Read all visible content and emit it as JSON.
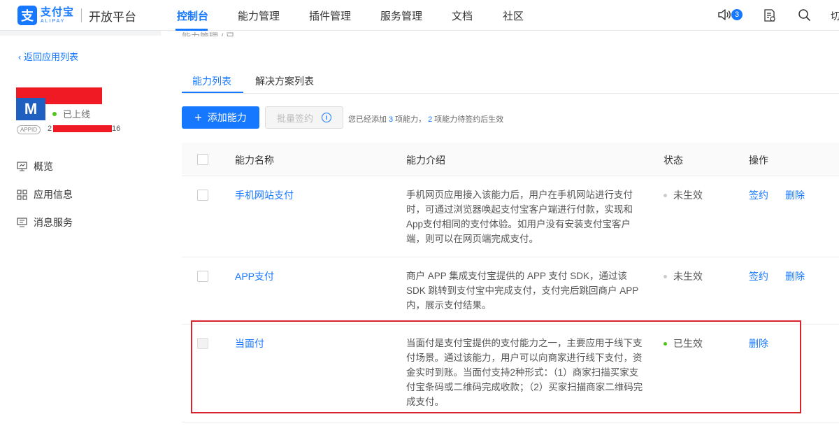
{
  "brand": {
    "logo_glyph": "支",
    "name_cn": "支付宝",
    "name_en": "ALIPAY",
    "platform": "开放平台",
    "color": "#1677ff"
  },
  "nav": {
    "items": [
      {
        "label": "控制台",
        "active": true
      },
      {
        "label": "能力管理"
      },
      {
        "label": "插件管理"
      },
      {
        "label": "服务管理"
      },
      {
        "label": "文档"
      },
      {
        "label": "社区"
      }
    ],
    "notification_count": "3",
    "icons": [
      "speaker-icon",
      "document-list-icon",
      "search-icon"
    ],
    "overflow_text": "切"
  },
  "sidebar": {
    "back_link": "返回应用列表",
    "app": {
      "logo_text": "M",
      "status": "已上线",
      "appid_tag": "APPID",
      "appid_prefix": "2",
      "appid_suffix": "16"
    },
    "items": [
      {
        "label": "概览",
        "icon": "monitor-icon"
      },
      {
        "label": "应用信息",
        "icon": "grid-icon"
      },
      {
        "label": "消息服务",
        "icon": "message-icon"
      }
    ]
  },
  "main": {
    "breadcrumb_fragment": "能力管理 / 已...",
    "tabs": [
      {
        "label": "能力列表",
        "active": true
      },
      {
        "label": "解决方案列表"
      }
    ],
    "add_button": "添加能力",
    "batch_sign_button": "批量签约",
    "summary": {
      "part1": "您已经添加",
      "count_added": "3",
      "part2": "项能力，",
      "count_pending": "2",
      "part3": "项能力待签约后生效"
    },
    "table": {
      "headers": {
        "name": "能力名称",
        "intro": "能力介绍",
        "status": "状态",
        "ops": "操作"
      },
      "rows": [
        {
          "name": "手机网站支付",
          "intro": "手机网页应用接入该能力后，用户在手机网站进行支付时，可通过浏览器唤起支付宝客户端进行付款，实现和App支付相同的支付体验。如用户没有安装支付宝客户端，则可以在网页端完成支付。",
          "status": "未生效",
          "sign": "签约",
          "delete": "删除"
        },
        {
          "name": "APP支付",
          "intro": "商户 APP 集成支付宝提供的 APP 支付 SDK，通过该 SDK 跳转到支付宝中完成支付，支付完后跳回商户 APP 内，展示支付结果。",
          "status": "未生效",
          "sign": "签约",
          "delete": "删除"
        },
        {
          "name": "当面付",
          "intro": "当面付是支付宝提供的支付能力之一，主要应用于线下支付场景。通过该能力，用户可以向商家进行线下支付，资金实时到账。当面付支持2种形式：（1）商家扫描买家支付宝条码或二维码完成收款；（2）买家扫描商家二维码完成支付。",
          "status": "已生效",
          "delete": "删除"
        }
      ]
    }
  },
  "colors": {
    "accent": "#1677ff",
    "active_status": "#52c41a",
    "inactive_status": "#cccccc",
    "annotation": "#d9232c"
  }
}
